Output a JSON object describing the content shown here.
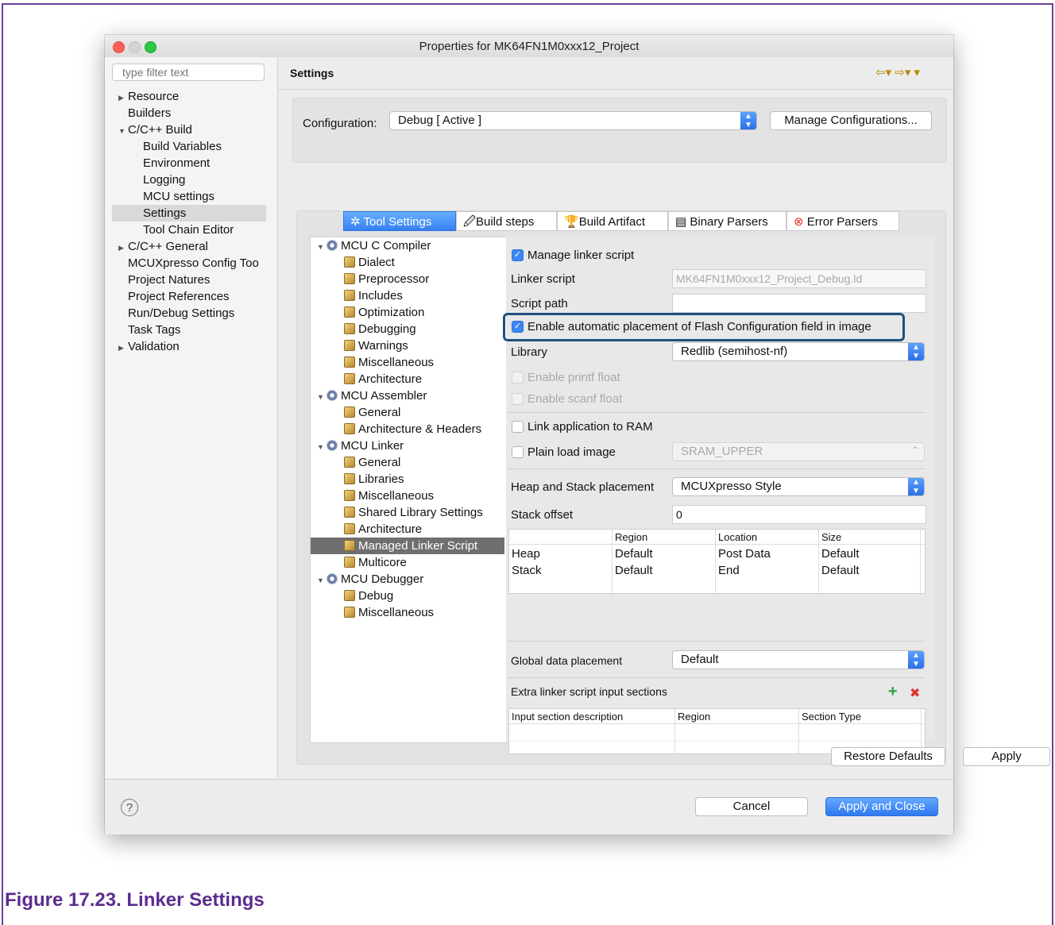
{
  "window": {
    "title": "Properties for MK64FN1M0xxx12_Project"
  },
  "sidebar": {
    "filter_placeholder": "type filter text",
    "items": [
      {
        "label": "Resource",
        "expander": "▶"
      },
      {
        "label": "Builders",
        "expander": ""
      },
      {
        "label": "C/C++ Build",
        "expander": "▼"
      },
      {
        "label": "Build Variables",
        "expander": ""
      },
      {
        "label": "Environment",
        "expander": ""
      },
      {
        "label": "Logging",
        "expander": ""
      },
      {
        "label": "MCU settings",
        "expander": ""
      },
      {
        "label": "Settings",
        "expander": ""
      },
      {
        "label": "Tool Chain Editor",
        "expander": ""
      },
      {
        "label": "C/C++ General",
        "expander": "▶"
      },
      {
        "label": "MCUXpresso Config Too",
        "expander": ""
      },
      {
        "label": "Project Natures",
        "expander": ""
      },
      {
        "label": "Project References",
        "expander": ""
      },
      {
        "label": "Run/Debug Settings",
        "expander": ""
      },
      {
        "label": "Task Tags",
        "expander": ""
      },
      {
        "label": "Validation",
        "expander": "▶"
      }
    ]
  },
  "header": {
    "title": "Settings",
    "nav": "⇦▾ ⇨▾ ▾"
  },
  "configuration": {
    "label": "Configuration:",
    "value": "Debug  [ Active ]",
    "manage_button": "Manage Configurations..."
  },
  "tabs": [
    {
      "icon": "✲",
      "label": "Tool Settings"
    },
    {
      "icon": "🖉",
      "label": "Build steps"
    },
    {
      "icon": "🏆",
      "label": "Build Artifact"
    },
    {
      "icon": "▤",
      "label": "Binary Parsers"
    },
    {
      "icon": "⊗",
      "label": "Error Parsers"
    }
  ],
  "tree": [
    {
      "label": "MCU C Compiler",
      "expander": "▼"
    },
    {
      "label": "Dialect"
    },
    {
      "label": "Preprocessor"
    },
    {
      "label": "Includes"
    },
    {
      "label": "Optimization"
    },
    {
      "label": "Debugging"
    },
    {
      "label": "Warnings"
    },
    {
      "label": "Miscellaneous"
    },
    {
      "label": "Architecture"
    },
    {
      "label": "MCU Assembler",
      "expander": "▼"
    },
    {
      "label": "General"
    },
    {
      "label": "Architecture & Headers"
    },
    {
      "label": "MCU Linker",
      "expander": "▼"
    },
    {
      "label": "General"
    },
    {
      "label": "Libraries"
    },
    {
      "label": "Miscellaneous"
    },
    {
      "label": "Shared Library Settings"
    },
    {
      "label": "Architecture"
    },
    {
      "label": "Managed Linker Script"
    },
    {
      "label": "Multicore"
    },
    {
      "label": "MCU Debugger",
      "expander": "▼"
    },
    {
      "label": "Debug"
    },
    {
      "label": "Miscellaneous"
    }
  ],
  "props": {
    "manage_linker_script": {
      "label": "Manage linker script",
      "checked": true
    },
    "linker_script": {
      "label": "Linker script",
      "value": "MK64FN1M0xxx12_Project_Debug.ld"
    },
    "script_path": {
      "label": "Script path",
      "value": ""
    },
    "flash_config": {
      "label": "Enable automatic placement of Flash Configuration field in image",
      "checked": true
    },
    "library": {
      "label": "Library",
      "value": "Redlib (semihost-nf)"
    },
    "printf_float": {
      "label": "Enable printf float",
      "checked": false
    },
    "scanf_float": {
      "label": "Enable scanf float",
      "checked": false
    },
    "link_to_ram": {
      "label": "Link application to RAM",
      "checked": false
    },
    "plain_load": {
      "label": "Plain load image",
      "checked": false,
      "value": "SRAM_UPPER"
    },
    "heap_stack": {
      "label": "Heap and Stack placement",
      "value": "MCUXpresso Style"
    },
    "stack_offset": {
      "label": "Stack offset",
      "value": "0"
    },
    "heap_table": {
      "headers": [
        "",
        "Region",
        "Location",
        "Size"
      ],
      "rows": [
        [
          "Heap",
          "Default",
          "Post Data",
          "Default"
        ],
        [
          "Stack",
          "Default",
          "End",
          "Default"
        ]
      ]
    },
    "global_data": {
      "label": "Global data placement",
      "value": "Default"
    },
    "extra_sections": {
      "label": "Extra linker script input sections",
      "add_icon": "+",
      "remove_icon": "✖",
      "headers": [
        "Input section description",
        "Region",
        "Section Type"
      ]
    }
  },
  "buttons": {
    "restore_defaults": "Restore Defaults",
    "apply": "Apply",
    "cancel": "Cancel",
    "apply_close": "Apply and Close",
    "help": "?"
  },
  "caption": "Figure 17.23. Linker Settings"
}
